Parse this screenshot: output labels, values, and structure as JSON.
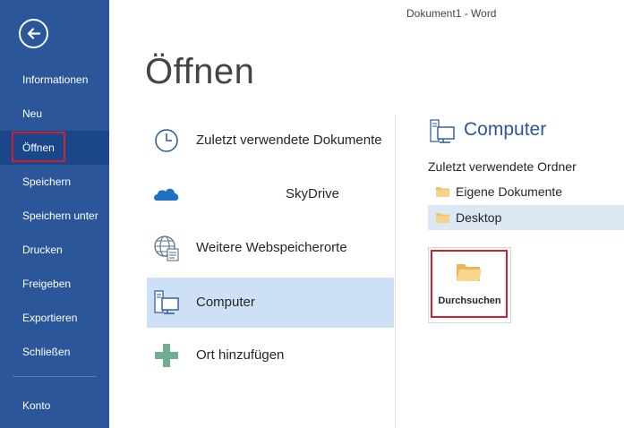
{
  "window": {
    "title": "Dokument1 - Word"
  },
  "page": {
    "title": "Öffnen"
  },
  "sidebar": {
    "items": [
      {
        "label": "Informationen"
      },
      {
        "label": "Neu"
      },
      {
        "label": "Öffnen"
      },
      {
        "label": "Speichern"
      },
      {
        "label": "Speichern unter"
      },
      {
        "label": "Drucken"
      },
      {
        "label": "Freigeben"
      },
      {
        "label": "Exportieren"
      },
      {
        "label": "Schließen"
      },
      {
        "label": "Konto"
      }
    ]
  },
  "places": [
    {
      "label": "Zuletzt verwendete Dokumente",
      "icon": "clock-icon"
    },
    {
      "label": "SkyDrive",
      "icon": "cloud-icon"
    },
    {
      "label": "Weitere Webspeicherorte",
      "icon": "globe-icon"
    },
    {
      "label": "Computer",
      "icon": "computer-icon"
    },
    {
      "label": "Ort hinzufügen",
      "icon": "plus-icon"
    }
  ],
  "computer_panel": {
    "title": "Computer",
    "recent_folders_label": "Zuletzt verwendete Ordner",
    "folders": [
      {
        "label": "Eigene Dokumente"
      },
      {
        "label": "Desktop"
      }
    ],
    "browse_label": "Durchsuchen"
  },
  "colors": {
    "sidebar": "#2b579a",
    "sidebar_active": "#19478a",
    "selected_place": "#cde0f5",
    "highlight_border": "#d0202e",
    "folder": "#f0c36d",
    "plus": "#6fae8e"
  }
}
